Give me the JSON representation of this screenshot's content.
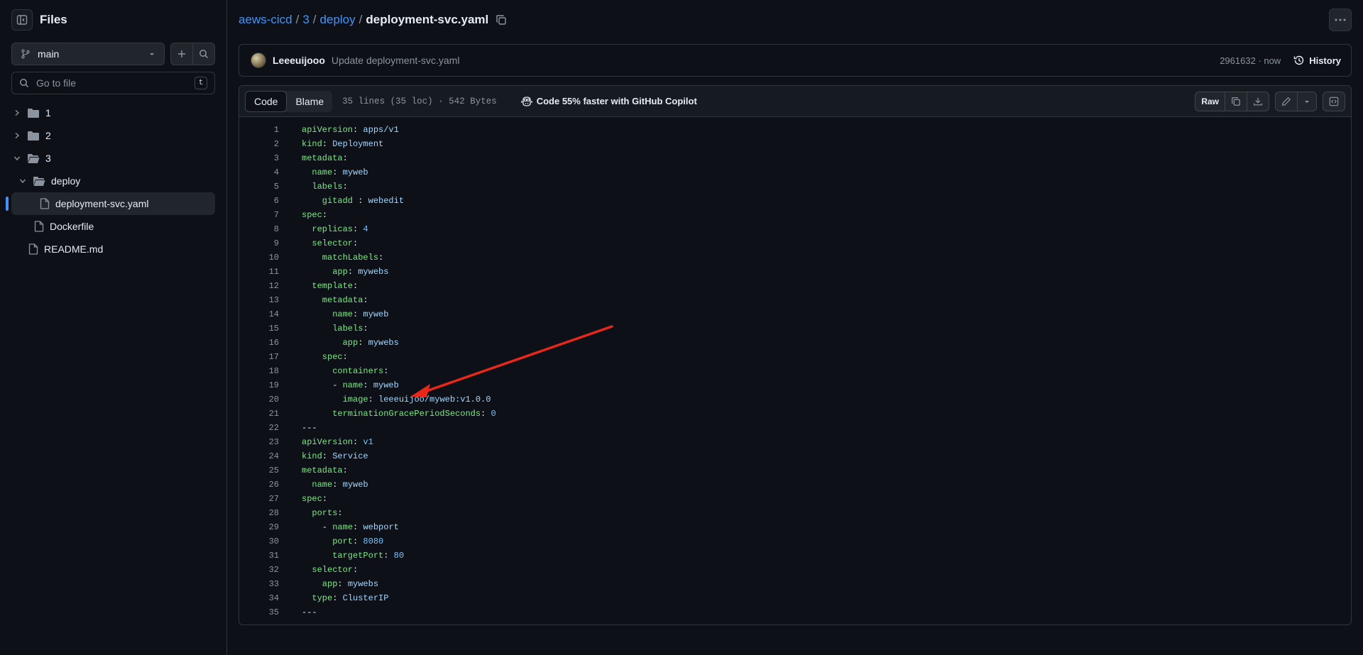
{
  "sidebar": {
    "title": "Files",
    "branch": "main",
    "search_placeholder": "Go to file",
    "search_shortcut": "t",
    "tree": [
      {
        "label": "1",
        "type": "folder",
        "expanded": false
      },
      {
        "label": "2",
        "type": "folder",
        "expanded": false
      },
      {
        "label": "3",
        "type": "folder",
        "expanded": true
      },
      {
        "label": "deploy",
        "type": "folder",
        "expanded": true
      },
      {
        "label": "deployment-svc.yaml",
        "type": "file",
        "active": true
      },
      {
        "label": "Dockerfile",
        "type": "file"
      },
      {
        "label": "README.md",
        "type": "file"
      }
    ]
  },
  "breadcrumb": {
    "repo": "aews-cicd",
    "folder1": "3",
    "folder2": "deploy",
    "file": "deployment-svc.yaml"
  },
  "commit": {
    "author": "Leeeuijooo",
    "message": "Update deployment-svc.yaml",
    "sha_time": "2961632 · now",
    "history_label": "History"
  },
  "file_header": {
    "tab_code": "Code",
    "tab_blame": "Blame",
    "meta": "35 lines (35 loc) · 542 Bytes",
    "copilot": "Code 55% faster with GitHub Copilot",
    "raw": "Raw"
  },
  "code_lines": [
    [
      [
        "apiVersion",
        "k"
      ],
      [
        ": ",
        ""
      ],
      [
        "apps/v1",
        "v"
      ]
    ],
    [
      [
        "kind",
        "k"
      ],
      [
        ": ",
        ""
      ],
      [
        "Deployment",
        "v"
      ]
    ],
    [
      [
        "metadata",
        "k"
      ],
      [
        ":",
        ""
      ]
    ],
    [
      [
        "  name",
        "k"
      ],
      [
        ": ",
        ""
      ],
      [
        "myweb",
        "v"
      ]
    ],
    [
      [
        "  labels",
        "k"
      ],
      [
        ":",
        ""
      ]
    ],
    [
      [
        "    gitadd ",
        "k"
      ],
      [
        ": ",
        ""
      ],
      [
        "webedit",
        "v"
      ]
    ],
    [
      [
        "spec",
        "k"
      ],
      [
        ":",
        ""
      ]
    ],
    [
      [
        "  replicas",
        "k"
      ],
      [
        ": ",
        ""
      ],
      [
        "4",
        "n"
      ]
    ],
    [
      [
        "  selector",
        "k"
      ],
      [
        ":",
        ""
      ]
    ],
    [
      [
        "    matchLabels",
        "k"
      ],
      [
        ":",
        ""
      ]
    ],
    [
      [
        "      app",
        "k"
      ],
      [
        ": ",
        ""
      ],
      [
        "mywebs",
        "v"
      ]
    ],
    [
      [
        "  template",
        "k"
      ],
      [
        ":",
        ""
      ]
    ],
    [
      [
        "    metadata",
        "k"
      ],
      [
        ":",
        ""
      ]
    ],
    [
      [
        "      name",
        "k"
      ],
      [
        ": ",
        ""
      ],
      [
        "myweb",
        "v"
      ]
    ],
    [
      [
        "      labels",
        "k"
      ],
      [
        ":",
        ""
      ]
    ],
    [
      [
        "        app",
        "k"
      ],
      [
        ": ",
        ""
      ],
      [
        "mywebs",
        "v"
      ]
    ],
    [
      [
        "    spec",
        "k"
      ],
      [
        ":",
        ""
      ]
    ],
    [
      [
        "      containers",
        "k"
      ],
      [
        ":",
        ""
      ]
    ],
    [
      [
        "      - ",
        ""
      ],
      [
        "name",
        "k"
      ],
      [
        ": ",
        ""
      ],
      [
        "myweb",
        "v"
      ]
    ],
    [
      [
        "        image",
        "k"
      ],
      [
        ": ",
        ""
      ],
      [
        "leeeuijoo/myweb:v1.0.0",
        "v"
      ]
    ],
    [
      [
        "      terminationGracePeriodSeconds",
        "k"
      ],
      [
        ": ",
        ""
      ],
      [
        "0",
        "n"
      ]
    ],
    [
      [
        "---",
        ""
      ]
    ],
    [
      [
        "apiVersion",
        "k"
      ],
      [
        ": ",
        ""
      ],
      [
        "v1",
        "n"
      ]
    ],
    [
      [
        "kind",
        "k"
      ],
      [
        ": ",
        ""
      ],
      [
        "Service",
        "v"
      ]
    ],
    [
      [
        "metadata",
        "k"
      ],
      [
        ":",
        ""
      ]
    ],
    [
      [
        "  name",
        "k"
      ],
      [
        ": ",
        ""
      ],
      [
        "myweb",
        "v"
      ]
    ],
    [
      [
        "spec",
        "k"
      ],
      [
        ":",
        ""
      ]
    ],
    [
      [
        "  ports",
        "k"
      ],
      [
        ":",
        ""
      ]
    ],
    [
      [
        "    - ",
        ""
      ],
      [
        "name",
        "k"
      ],
      [
        ": ",
        ""
      ],
      [
        "webport",
        "v"
      ]
    ],
    [
      [
        "      port",
        "k"
      ],
      [
        ": ",
        ""
      ],
      [
        "8080",
        "n"
      ]
    ],
    [
      [
        "      targetPort",
        "k"
      ],
      [
        ": ",
        ""
      ],
      [
        "80",
        "n"
      ]
    ],
    [
      [
        "  selector",
        "k"
      ],
      [
        ":",
        ""
      ]
    ],
    [
      [
        "    app",
        "k"
      ],
      [
        ": ",
        ""
      ],
      [
        "mywebs",
        "v"
      ]
    ],
    [
      [
        "  type",
        "k"
      ],
      [
        ": ",
        ""
      ],
      [
        "ClusterIP",
        "v"
      ]
    ],
    [
      [
        "---",
        ""
      ]
    ]
  ],
  "colors": {
    "accent": "#4493f8",
    "key": "#7ee787",
    "value": "#a5d6ff",
    "number": "#79c0ff",
    "annotation_arrow": "#e8271b"
  }
}
